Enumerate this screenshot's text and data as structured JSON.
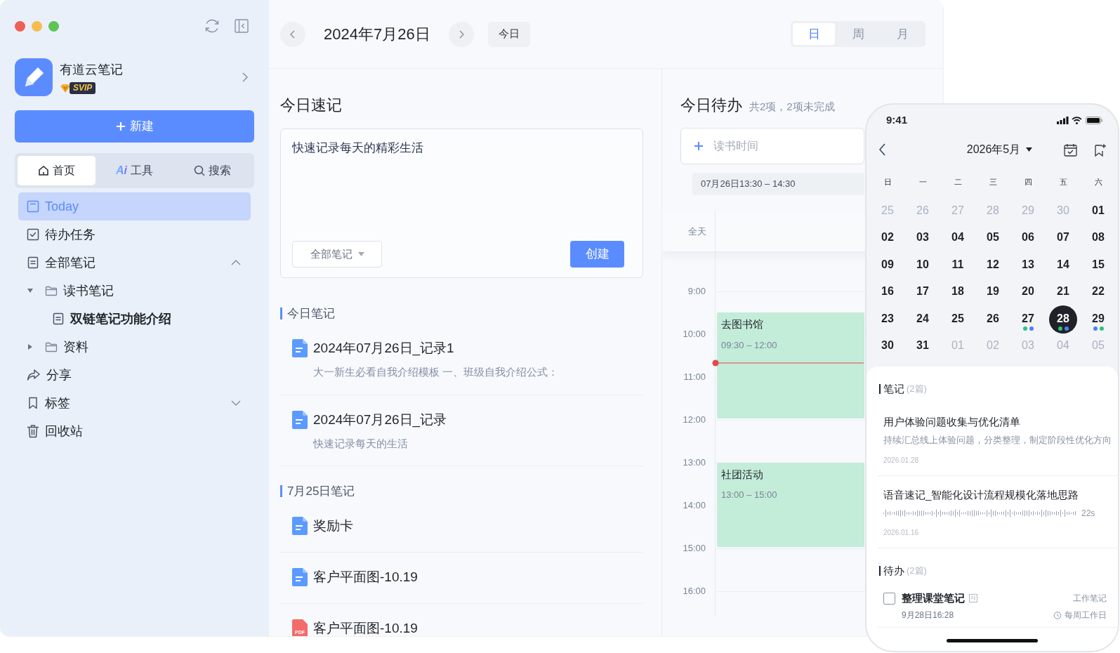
{
  "sidebar": {
    "app_name": "有道云笔记",
    "badge": "SVIP",
    "new_button": "新建",
    "tabs": [
      {
        "kind": "home",
        "label": "首页",
        "selected": true
      },
      {
        "kind": "ai",
        "icon_text": "Ai",
        "label": "工具",
        "selected": false
      },
      {
        "kind": "search",
        "label": "搜索",
        "selected": false
      }
    ],
    "nav": [
      {
        "kind": "today",
        "label": "Today",
        "selected": true
      },
      {
        "kind": "todo",
        "label": "待办任务",
        "selected": false
      },
      {
        "kind": "notes",
        "label": "全部笔记",
        "selected": false,
        "expanded": true,
        "children": [
          {
            "kind": "folder",
            "label": "读书笔记",
            "selected": false,
            "expanded": true,
            "children": [
              {
                "kind": "doc",
                "label": "双链笔记功能介绍",
                "selected": false
              }
            ]
          },
          {
            "kind": "folder",
            "label": "资料",
            "selected": false,
            "expanded": false
          }
        ]
      },
      {
        "kind": "share",
        "label": "分享",
        "selected": false
      },
      {
        "kind": "tags",
        "label": "标签",
        "selected": false,
        "expanded": false
      },
      {
        "kind": "trash",
        "label": "回收站",
        "selected": false
      }
    ]
  },
  "header": {
    "date": "2024年7月26日",
    "today_button": "今日",
    "views": [
      {
        "label": "日",
        "selected": true
      },
      {
        "label": "周",
        "selected": false
      },
      {
        "label": "月",
        "selected": false
      }
    ]
  },
  "quick_note": {
    "title": "今日速记",
    "value": "快速记录每天的精彩生活",
    "notebook": "全部笔记",
    "create_button": "创建"
  },
  "note_groups": [
    {
      "title": "今日笔记",
      "notes": [
        {
          "kind": "doc",
          "title": "2024年07月26日_记录1",
          "snippet": "大一新生必看自我介绍模板 一、班级自我介绍公式："
        },
        {
          "kind": "doc",
          "title": "2024年07月26日_记录",
          "snippet": "快速记录每天的生活"
        }
      ]
    },
    {
      "title": "7月25日笔记",
      "notes": [
        {
          "kind": "doc",
          "title": "奖励卡"
        },
        {
          "kind": "doc",
          "title": "客户平面图-10.19"
        },
        {
          "kind": "pdf",
          "icon_text": "PDF",
          "title": "客户平面图-10.19"
        }
      ]
    }
  ],
  "todos": {
    "title": "今日待办",
    "summary": "共2项，2项未完成",
    "placeholder": "读书时间",
    "time_chip": "07月26日13:30 – 14:30",
    "all_day_label": "全天",
    "hours": [
      "9:00",
      "10:00",
      "11:00",
      "12:00",
      "13:00",
      "14:00",
      "15:00",
      "16:00"
    ],
    "events": [
      {
        "title": "去图书馆",
        "time": "09:30 – 12:00"
      },
      {
        "title": "社团活动",
        "time": "13:00 – 15:00"
      }
    ]
  },
  "phone": {
    "time": "9:41",
    "month": "2026年5月",
    "weekdays": [
      "日",
      "一",
      "二",
      "三",
      "四",
      "五",
      "六"
    ],
    "days": [
      {
        "label": "25",
        "muted": true,
        "selected": false
      },
      {
        "label": "26",
        "muted": true,
        "selected": false
      },
      {
        "label": "27",
        "muted": true,
        "selected": false
      },
      {
        "label": "28",
        "muted": true,
        "selected": false
      },
      {
        "label": "29",
        "muted": true,
        "selected": false
      },
      {
        "label": "30",
        "muted": true,
        "selected": false
      },
      {
        "label": "01",
        "muted": false,
        "selected": false
      },
      {
        "label": "02",
        "muted": false,
        "selected": false
      },
      {
        "label": "03",
        "muted": false,
        "selected": false
      },
      {
        "label": "04",
        "muted": false,
        "selected": false
      },
      {
        "label": "05",
        "muted": false,
        "selected": false
      },
      {
        "label": "06",
        "muted": false,
        "selected": false
      },
      {
        "label": "07",
        "muted": false,
        "selected": false
      },
      {
        "label": "08",
        "muted": false,
        "selected": false
      },
      {
        "label": "09",
        "muted": false,
        "selected": false
      },
      {
        "label": "10",
        "muted": false,
        "selected": false
      },
      {
        "label": "11",
        "muted": false,
        "selected": false
      },
      {
        "label": "12",
        "muted": false,
        "selected": false
      },
      {
        "label": "13",
        "muted": false,
        "selected": false
      },
      {
        "label": "14",
        "muted": false,
        "selected": false
      },
      {
        "label": "15",
        "muted": false,
        "selected": false
      },
      {
        "label": "16",
        "muted": false,
        "selected": false
      },
      {
        "label": "17",
        "muted": false,
        "selected": false
      },
      {
        "label": "18",
        "muted": false,
        "selected": false
      },
      {
        "label": "19",
        "muted": false,
        "selected": false
      },
      {
        "label": "20",
        "muted": false,
        "selected": false
      },
      {
        "label": "21",
        "muted": false,
        "selected": false
      },
      {
        "label": "22",
        "muted": false,
        "selected": false
      },
      {
        "label": "23",
        "muted": false,
        "selected": false
      },
      {
        "label": "24",
        "muted": false,
        "selected": false
      },
      {
        "label": "25",
        "muted": false,
        "selected": false
      },
      {
        "label": "26",
        "muted": false,
        "selected": false
      },
      {
        "label": "27",
        "muted": false,
        "selected": false,
        "dots": [
          {
            "color": "#2ec27e"
          },
          {
            "color": "#4f7cff"
          }
        ]
      },
      {
        "label": "28",
        "muted": false,
        "selected": true,
        "dots": [
          {
            "color": "#2ec27e"
          },
          {
            "color": "#4f7cff"
          }
        ]
      },
      {
        "label": "29",
        "muted": false,
        "selected": false,
        "dots": [
          {
            "color": "#4f7cff"
          },
          {
            "color": "#2ec27e"
          }
        ]
      },
      {
        "label": "30",
        "muted": false,
        "selected": false
      },
      {
        "label": "31",
        "muted": false,
        "selected": false
      },
      {
        "label": "01",
        "muted": true,
        "selected": false
      },
      {
        "label": "02",
        "muted": true,
        "selected": false
      },
      {
        "label": "03",
        "muted": true,
        "selected": false
      },
      {
        "label": "04",
        "muted": true,
        "selected": false
      },
      {
        "label": "05",
        "muted": true,
        "selected": false
      }
    ],
    "notes_section": {
      "title": "笔记",
      "count": "(2篇)"
    },
    "notes": [
      {
        "kind": "text",
        "title": "用户体验问题收集与优化清单",
        "snippet": "持续汇总线上体验问题，分类整理，制定阶段性优化方向",
        "date": "2026.01.28"
      },
      {
        "kind": "voice",
        "title": "语音速记_智能化设计流程规模化落地思路",
        "duration": "22s",
        "date": "2026.01.16"
      }
    ],
    "todo_section": {
      "title": "待办",
      "count": "(2篇)"
    },
    "todos": [
      {
        "title": "整理课堂笔记",
        "checked": false,
        "tag": "工作笔记",
        "due": "9月28日16:28",
        "repeat": "每周工作日"
      }
    ]
  }
}
